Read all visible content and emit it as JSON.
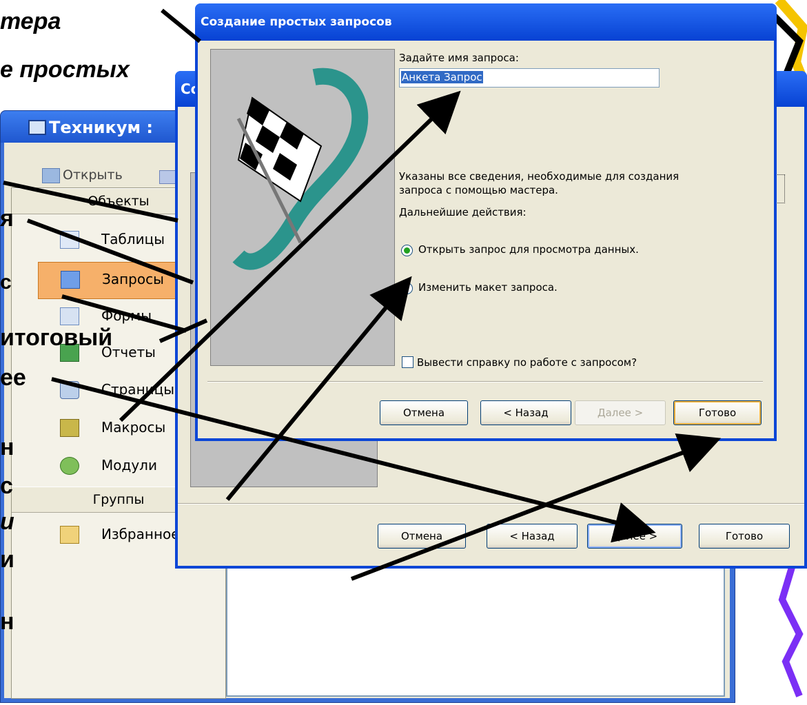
{
  "slide_text": [
    "тера",
    "е простых",
    "я",
    "с",
    "итоговый",
    "ее",
    "н",
    "с",
    "и",
    "и",
    "н"
  ],
  "main_window": {
    "title": "Техникум :",
    "toolbar": {
      "open_label": "Открыть"
    },
    "objects_header": "Объекты",
    "objects": [
      "Таблицы",
      "Запросы",
      "Формы",
      "Отчеты",
      "Страницы",
      "Макросы",
      "Модули"
    ],
    "groups_header": "Группы",
    "groups": [
      "Избранное"
    ]
  },
  "wizard_back": {
    "title": "Со",
    "buttons": {
      "cancel": "Отмена",
      "back": "< Назад",
      "next": "Далее >",
      "finish": "Готово"
    }
  },
  "wizard_front": {
    "title": "Создание простых запросов",
    "name_prompt": "Задайте имя запроса:",
    "name_value": "Анкета Запрос",
    "info_line1": "Указаны все сведения, необходимые для создания",
    "info_line2": "запроса с помощью мастера.",
    "next_steps": "Дальнейшие действия:",
    "option_open": "Открыть запрос для просмотра данных.",
    "option_modify": "Изменить макет запроса.",
    "help_checkbox": "Вывести справку по работе с запросом?",
    "buttons": {
      "cancel": "Отмена",
      "back": "< Назад",
      "next": "Далее >",
      "finish": "Готово"
    }
  },
  "colors": {
    "title_bar": "#0742d3",
    "dialog_face": "#ece9d8",
    "selected_item": "#f6b06a",
    "accent_purple": "#7b2ff5",
    "accent_yellow": "#f5c400"
  }
}
